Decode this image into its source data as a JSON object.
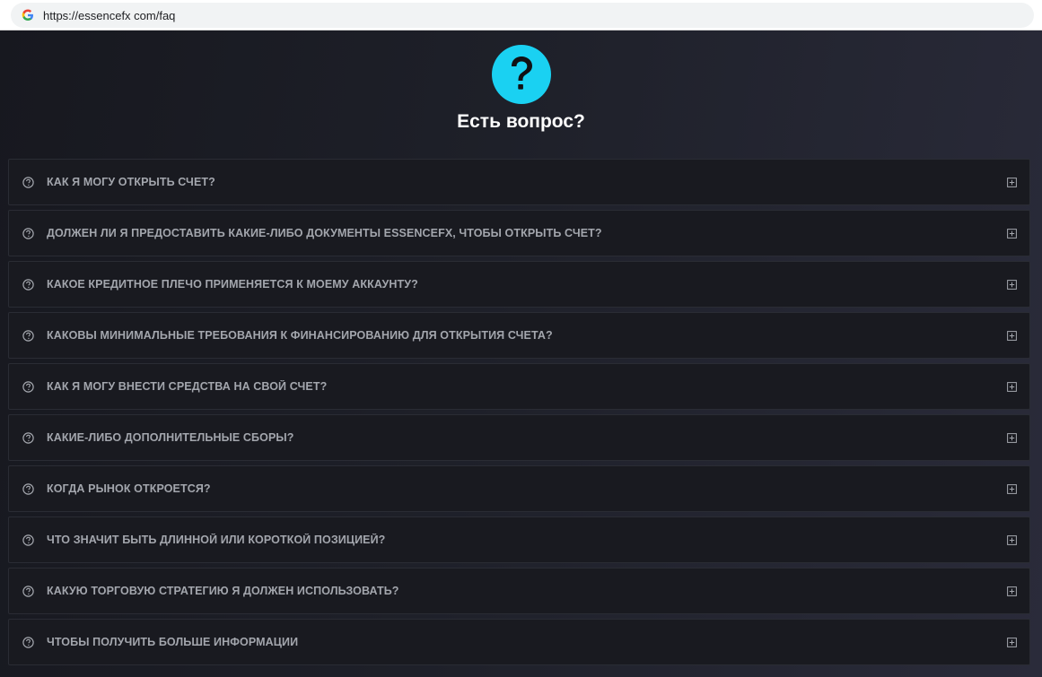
{
  "browser": {
    "url": "https://essencefx com/faq",
    "favicon_icon": "google-g-icon"
  },
  "hero": {
    "icon": "question-mark-icon",
    "icon_color": "#1ad1f2",
    "title": "Есть вопрос?"
  },
  "faq": {
    "item_icon": "question-circle-icon",
    "expand_icon": "plus-square-icon",
    "items": [
      {
        "label": "КАК Я МОГУ ОТКРЫТЬ СЧЕТ?"
      },
      {
        "label": "ДОЛЖЕН ЛИ Я ПРЕДОСТАВИТЬ КАКИЕ-ЛИБО ДОКУМЕНТЫ ESSENCEFX, ЧТОБЫ ОТКРЫТЬ СЧЕТ?"
      },
      {
        "label": "КАКОЕ КРЕДИТНОЕ ПЛЕЧО ПРИМЕНЯЕТСЯ К МОЕМУ АККАУНТУ?"
      },
      {
        "label": "КАКОВЫ МИНИМАЛЬНЫЕ ТРЕБОВАНИЯ К ФИНАНСИРОВАНИЮ ДЛЯ ОТКРЫТИЯ СЧЕТА?"
      },
      {
        "label": "КАК Я МОГУ ВНЕСТИ СРЕДСТВА НА СВОЙ СЧЕТ?"
      },
      {
        "label": "КАКИЕ-ЛИБО ДОПОЛНИТЕЛЬНЫЕ СБОРЫ?"
      },
      {
        "label": "КОГДА РЫНОК ОТКРОЕТСЯ?"
      },
      {
        "label": "ЧТО ЗНАЧИТ БЫТЬ ДЛИННОЙ ИЛИ КОРОТКОЙ ПОЗИЦИЕЙ?"
      },
      {
        "label": "КАКУЮ ТОРГОВУЮ СТРАТЕГИЮ Я ДОЛЖЕН ИСПОЛЬЗОВАТЬ?"
      },
      {
        "label": "ЧТОБЫ ПОЛУЧИТЬ БОЛЬШЕ ИНФОРМАЦИИ"
      }
    ]
  }
}
